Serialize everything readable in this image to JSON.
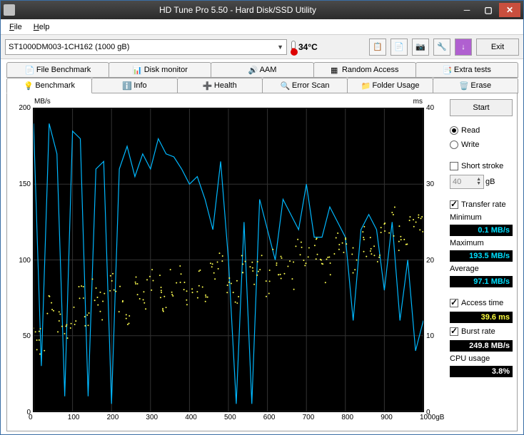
{
  "titlebar": {
    "title": "HD Tune Pro 5.50 - Hard Disk/SSD Utility"
  },
  "menubar": {
    "file": "File",
    "help": "Help"
  },
  "toolbar": {
    "drive": "ST1000DM003-1CH162 (1000 gB)",
    "temperature": "34°C",
    "exit": "Exit"
  },
  "tabs_row1": {
    "file_benchmark": "File Benchmark",
    "disk_monitor": "Disk monitor",
    "aam": "AAM",
    "random_access": "Random Access",
    "extra_tests": "Extra tests"
  },
  "tabs_row2": {
    "benchmark": "Benchmark",
    "info": "Info",
    "health": "Health",
    "error_scan": "Error Scan",
    "folder_usage": "Folder Usage",
    "erase": "Erase"
  },
  "chart": {
    "y_left_label": "MB/s",
    "y_right_label": "ms",
    "y_left_ticks": [
      "200",
      "150",
      "100",
      "50",
      "0"
    ],
    "y_right_ticks": [
      "40",
      "30",
      "20",
      "10",
      "0"
    ],
    "x_ticks": [
      "0",
      "100",
      "200",
      "300",
      "400",
      "500",
      "600",
      "700",
      "800",
      "900",
      "1000gB"
    ]
  },
  "side": {
    "start": "Start",
    "read": "Read",
    "write": "Write",
    "short_stroke": "Short stroke",
    "short_stroke_val": "40",
    "short_stroke_unit": "gB",
    "transfer_rate": "Transfer rate",
    "minimum": "Minimum",
    "minimum_val": "0.1 MB/s",
    "maximum": "Maximum",
    "maximum_val": "193.5 MB/s",
    "average": "Average",
    "average_val": "97.1 MB/s",
    "access_time": "Access time",
    "access_time_val": "39.6 ms",
    "burst_rate": "Burst rate",
    "burst_rate_val": "249.8 MB/s",
    "cpu_usage": "CPU usage",
    "cpu_usage_val": "3.8%"
  },
  "chart_data": {
    "type": "line",
    "title": "",
    "xlabel": "gB",
    "xlim": [
      0,
      1000
    ],
    "y_left_label": "MB/s",
    "y_left_lim": [
      0,
      200
    ],
    "y_right_label": "ms",
    "y_right_lim": [
      0,
      40
    ],
    "x": [
      0,
      20,
      40,
      60,
      80,
      100,
      120,
      140,
      160,
      180,
      200,
      220,
      240,
      260,
      280,
      300,
      320,
      340,
      360,
      380,
      400,
      420,
      440,
      460,
      480,
      500,
      520,
      540,
      560,
      580,
      600,
      620,
      640,
      660,
      680,
      700,
      720,
      740,
      760,
      780,
      800,
      820,
      840,
      860,
      880,
      900,
      920,
      940,
      960,
      980,
      1000
    ],
    "series": [
      {
        "name": "Transfer rate",
        "axis": "left",
        "color": "#00b8ff",
        "values": [
          190,
          30,
          190,
          170,
          10,
          185,
          180,
          10,
          160,
          165,
          5,
          160,
          175,
          155,
          170,
          160,
          180,
          170,
          168,
          160,
          150,
          155,
          140,
          120,
          165,
          100,
          5,
          125,
          5,
          140,
          120,
          100,
          140,
          130,
          120,
          150,
          115,
          115,
          135,
          125,
          115,
          60,
          120,
          130,
          120,
          80,
          125,
          60,
          100,
          40,
          60
        ]
      },
      {
        "name": "Access time",
        "axis": "right",
        "color": "#ffff50",
        "style": "scatter",
        "values": [
          10,
          9,
          14,
          12,
          11,
          13,
          15,
          12,
          16,
          14,
          17,
          15,
          13,
          16,
          15,
          17,
          16,
          14,
          17,
          18,
          16,
          17,
          15,
          18,
          19,
          17,
          16,
          20,
          18,
          19,
          17,
          20,
          19,
          18,
          21,
          20,
          22,
          19,
          20,
          22,
          21,
          20,
          23,
          22,
          21,
          24,
          25,
          23,
          24,
          26,
          25
        ]
      }
    ]
  }
}
